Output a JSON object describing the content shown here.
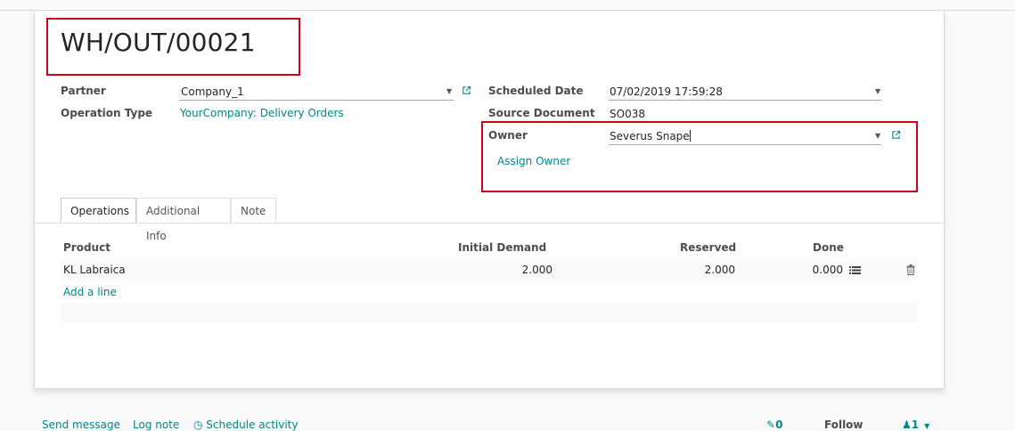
{
  "record": {
    "title": "WH/OUT/00021"
  },
  "form": {
    "partner": {
      "label": "Partner",
      "value": "Company_1"
    },
    "operation_type": {
      "label": "Operation Type",
      "value": "YourCompany: Delivery Orders"
    },
    "scheduled_date": {
      "label": "Scheduled Date",
      "value": "07/02/2019 17:59:28"
    },
    "source_document": {
      "label": "Source Document",
      "value": "SO038"
    },
    "owner": {
      "label": "Owner",
      "value": "Severus Snape"
    },
    "assign_owner": {
      "label": "Assign Owner"
    }
  },
  "tabs": [
    {
      "label": "Operations",
      "active": true
    },
    {
      "label": "Additional Info",
      "active": false
    },
    {
      "label": "Note",
      "active": false
    }
  ],
  "table": {
    "headers": {
      "product": "Product",
      "initial_demand": "Initial Demand",
      "reserved": "Reserved",
      "done": "Done"
    },
    "rows": [
      {
        "product": "KL Labraica",
        "initial_demand": "2.000",
        "reserved": "2.000",
        "done": "0.000"
      }
    ],
    "add_line": "Add a line"
  },
  "chatter": {
    "send_message": "Send message",
    "log_note": "Log note",
    "schedule_activity": "Schedule activity",
    "attachments_count": "0",
    "follow": "Follow",
    "followers_count": "1"
  },
  "colors": {
    "link": "#00868b",
    "highlight": "#d0021b"
  }
}
